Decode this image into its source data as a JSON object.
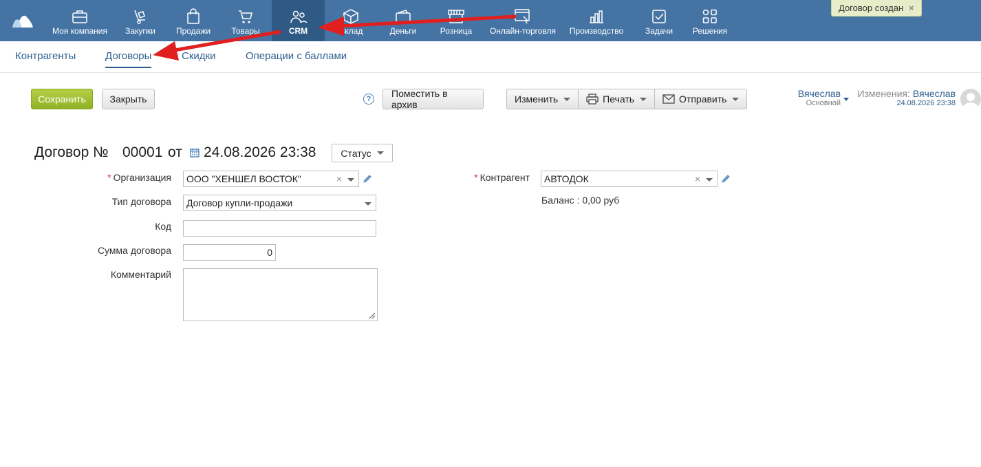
{
  "topnav": {
    "items": [
      {
        "label": "Моя компания",
        "icon": "briefcase-icon"
      },
      {
        "label": "Закупки",
        "icon": "cart-dolly-icon"
      },
      {
        "label": "Продажи",
        "icon": "shopping-bag-icon"
      },
      {
        "label": "Товары",
        "icon": "shopping-cart-icon"
      },
      {
        "label": "CRM",
        "icon": "users-icon"
      },
      {
        "label": "Склад",
        "icon": "boxes-icon"
      },
      {
        "label": "Деньги",
        "icon": "wallet-icon"
      },
      {
        "label": "Розница",
        "icon": "store-icon"
      },
      {
        "label": "Онлайн-торговля",
        "icon": "online-store-icon"
      },
      {
        "label": "Производство",
        "icon": "bar-chart-icon"
      },
      {
        "label": "Задачи",
        "icon": "checkbox-icon"
      },
      {
        "label": "Решения",
        "icon": "apps-grid-icon"
      }
    ],
    "active": "CRM"
  },
  "toast": {
    "text": "Договор создан",
    "close": "×"
  },
  "subtabs": [
    {
      "label": "Контрагенты"
    },
    {
      "label": "Договоры"
    },
    {
      "label": "Скидки"
    },
    {
      "label": "Операции с баллами"
    }
  ],
  "toolbar": {
    "save": "Сохранить",
    "close": "Закрыть",
    "help": "?",
    "archive": "Поместить в архив",
    "edit": "Изменить",
    "print": "Печать",
    "send": "Отправить"
  },
  "user": {
    "name": "Вячеслав",
    "role": "Основной"
  },
  "changes": {
    "label": "Изменения:",
    "by": "Вячеслав",
    "date": "24.08.2026 23:38"
  },
  "doc": {
    "title": "Договор №",
    "number": "00001",
    "from": "от",
    "date": "24.08.2026 23:38",
    "status": "Статус"
  },
  "form": {
    "organization": {
      "label": "Организация",
      "value": "ООО \"ХЕНШЕЛ ВОСТОК\""
    },
    "contract_type": {
      "label": "Тип договора",
      "value": "Договор купли-продажи"
    },
    "code": {
      "label": "Код",
      "value": ""
    },
    "amount": {
      "label": "Сумма договора",
      "value": "0"
    },
    "comment": {
      "label": "Комментарий",
      "value": ""
    },
    "counterparty": {
      "label": "Контрагент",
      "value": "АВТОДОК"
    },
    "balance": "Баланс : 0,00 руб"
  },
  "colors": {
    "nav": "#4574a4",
    "nav_active": "#2f5a86",
    "save": "#9bbc2d",
    "link": "#2e5f8f",
    "arrow": "#e02020"
  }
}
